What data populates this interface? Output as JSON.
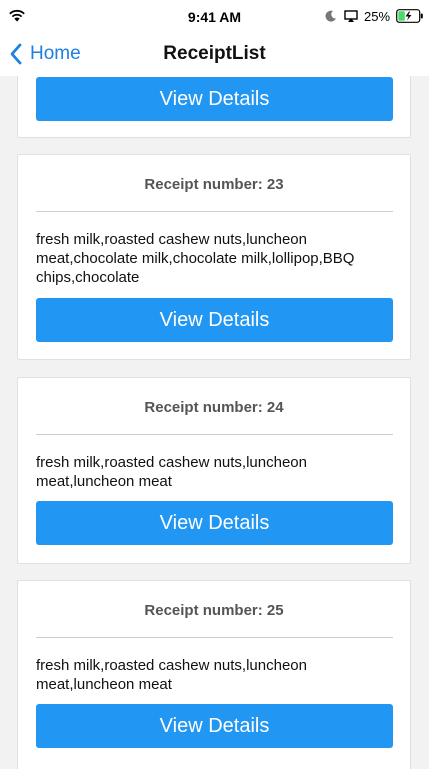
{
  "status_bar": {
    "time": "9:41 AM",
    "battery_percent": "25%",
    "icons": [
      "wifi-icon",
      "moon-icon",
      "airplay-icon",
      "battery-icon"
    ]
  },
  "nav": {
    "back_label": "Home",
    "title": "ReceiptList"
  },
  "colors": {
    "accent": "#2196f3",
    "back_link": "#1e7fe0",
    "background": "#f2f2f2"
  },
  "receipts": [
    {
      "button_label": "View Details"
    },
    {
      "heading": "Receipt number: 23",
      "items": "fresh milk,roasted cashew nuts,luncheon meat,chocolate milk,chocolate milk,lollipop,BBQ chips,chocolate",
      "button_label": "View Details"
    },
    {
      "heading": "Receipt number: 24",
      "items": "fresh milk,roasted cashew nuts,luncheon meat,luncheon meat",
      "button_label": "View Details"
    },
    {
      "heading": "Receipt number: 25",
      "items": "fresh milk,roasted cashew nuts,luncheon meat,luncheon meat",
      "button_label": "View Details"
    }
  ]
}
